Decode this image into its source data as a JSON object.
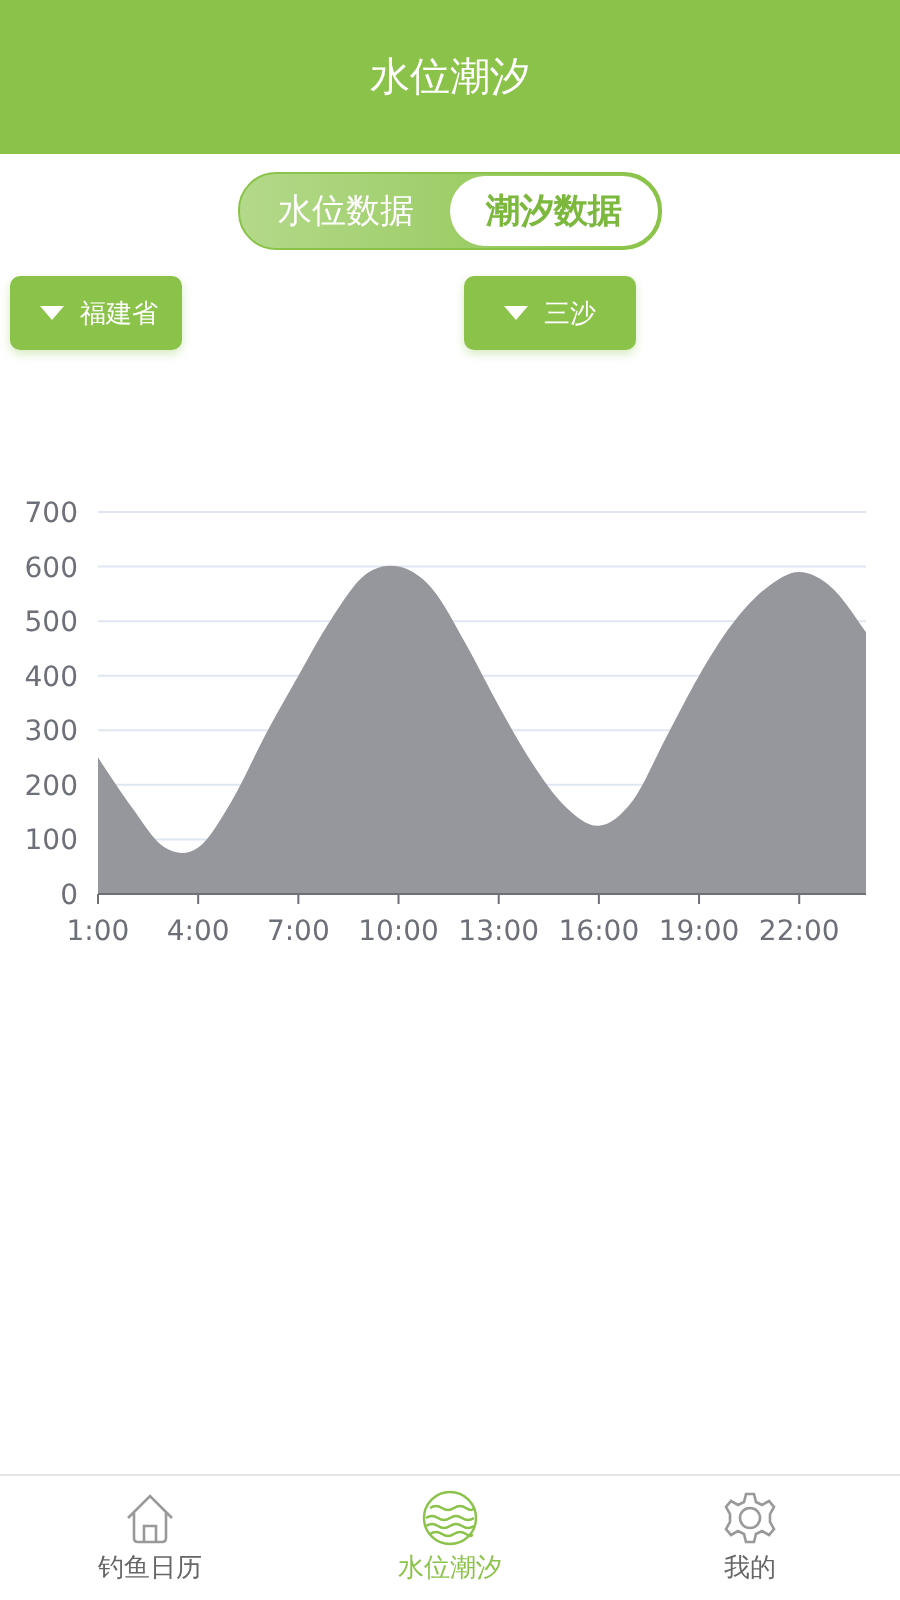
{
  "header": {
    "title": "水位潮汐"
  },
  "tabs": [
    {
      "label": "水位数据",
      "selected": false
    },
    {
      "label": "潮汐数据",
      "selected": true
    }
  ],
  "filters": [
    {
      "label": "福建省"
    },
    {
      "label": "三沙"
    }
  ],
  "chart": {
    "chart_data": {
      "type": "area",
      "x": [
        1,
        2,
        3,
        4,
        5,
        6,
        7,
        8,
        9,
        10,
        11,
        12,
        13,
        14,
        15,
        16,
        17,
        18,
        19,
        20,
        21,
        22,
        23,
        24
      ],
      "grid": true,
      "series": [
        {
          "color": "#96979c",
          "values": [
            250,
            160,
            85,
            85,
            170,
            290,
            400,
            505,
            585,
            600,
            560,
            460,
            345,
            240,
            160,
            125,
            170,
            285,
            400,
            495,
            560,
            590,
            560,
            480
          ]
        }
      ],
      "xlim": [
        1,
        24
      ],
      "ylim": [
        0,
        700
      ],
      "xticks": [
        {
          "value": 1,
          "label": "1:00"
        },
        {
          "value": 4,
          "label": "4:00"
        },
        {
          "value": 7,
          "label": "7:00"
        },
        {
          "value": 10,
          "label": "10:00"
        },
        {
          "value": 13,
          "label": "13:00"
        },
        {
          "value": 16,
          "label": "16:00"
        },
        {
          "value": 19,
          "label": "19:00"
        },
        {
          "value": 22,
          "label": "22:00"
        }
      ],
      "yticks": [
        0,
        100,
        200,
        300,
        400,
        500,
        600,
        700
      ]
    }
  },
  "nav": [
    {
      "label": "钓鱼日历",
      "kind": "home",
      "selected": false
    },
    {
      "label": "水位潮汐",
      "kind": "waves",
      "selected": true
    },
    {
      "label": "我的",
      "kind": "gear",
      "selected": false
    }
  ]
}
